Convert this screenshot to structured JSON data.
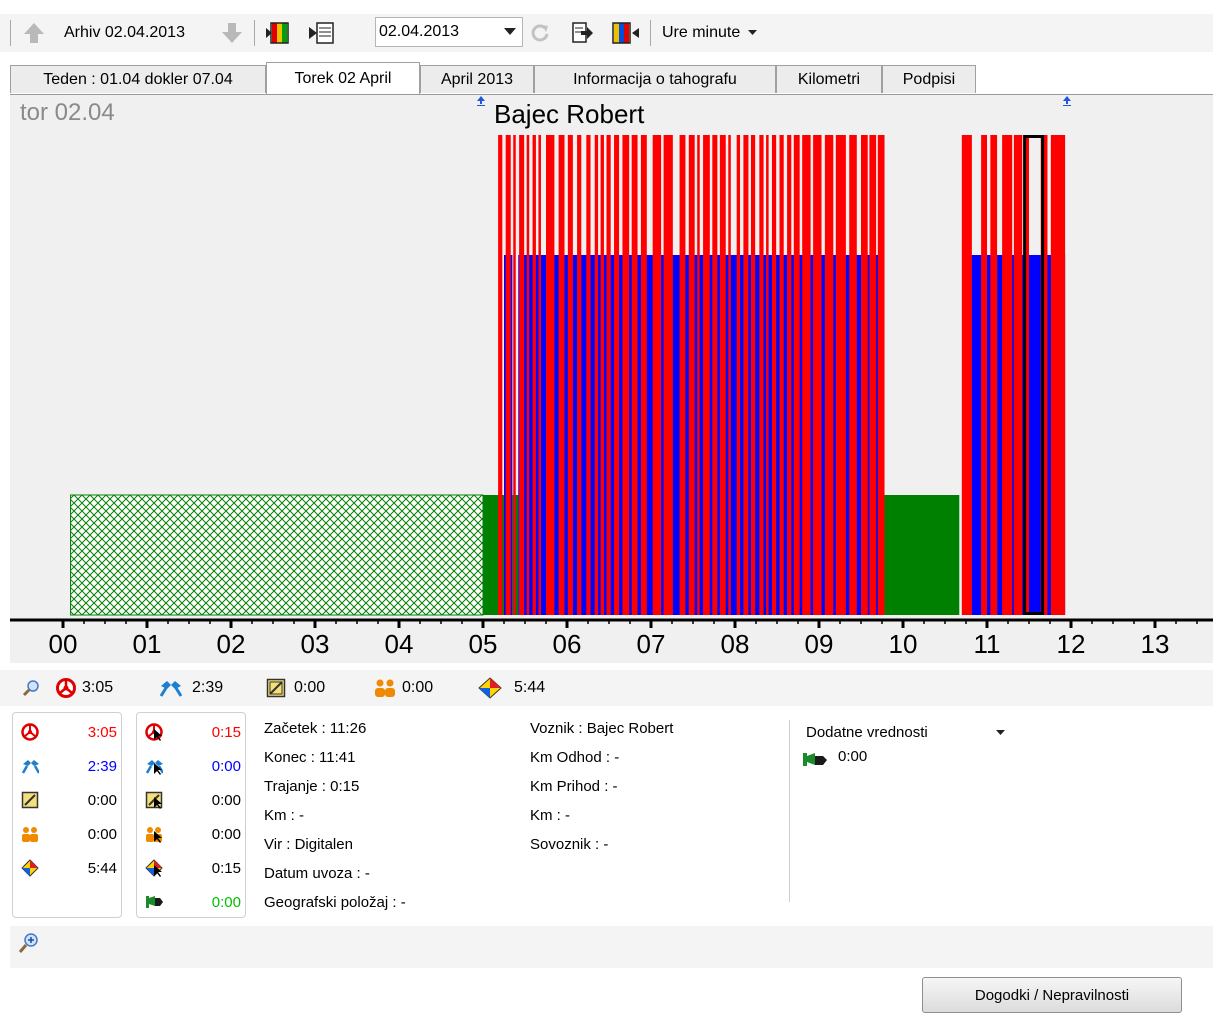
{
  "toolbar": {
    "archive_label": "Arhiv 02.04.2013",
    "date_value": "02.04.2013",
    "mode_label": "Ure minute"
  },
  "tabs": [
    {
      "label": "Teden : 01.04 dokler 07.04",
      "active": false
    },
    {
      "label": "Torek 02 April",
      "active": true
    },
    {
      "label": "April 2013",
      "active": false
    },
    {
      "label": "Informacija o tahografu",
      "active": false
    },
    {
      "label": "Kilometri",
      "active": false
    },
    {
      "label": "Podpisi",
      "active": false
    }
  ],
  "chart": {
    "day_label": "tor 02.04",
    "driver_name": "Bajec Robert"
  },
  "chart_data": {
    "type": "bar",
    "x_ticks": [
      "00",
      "01",
      "02",
      "03",
      "04",
      "05",
      "06",
      "07",
      "08",
      "09",
      "10",
      "11",
      "12",
      "13"
    ],
    "xlim": [
      0,
      13.6
    ],
    "activity_levels": {
      "rest": 1,
      "work": 3,
      "driving": 4
    },
    "segments": [
      {
        "activity": "rest_hatched",
        "start": 0.09,
        "end": 5.0
      },
      {
        "activity": "rest",
        "start": 5.0,
        "end": 5.25
      },
      {
        "activity": "work",
        "start": 5.25,
        "end": 5.35
      },
      {
        "activity": "rest",
        "start": 5.35,
        "end": 5.42
      },
      {
        "activity": "work",
        "start": 5.42,
        "end": 9.75
      },
      {
        "activity": "rest",
        "start": 9.78,
        "end": 10.67
      },
      {
        "activity": "work",
        "start": 10.78,
        "end": 11.05
      },
      {
        "activity": "rest",
        "start": 11.05,
        "end": 11.12
      },
      {
        "activity": "work",
        "start": 11.12,
        "end": 11.93
      }
    ],
    "driving_segments": [
      [
        5.18,
        5.23
      ],
      [
        5.27,
        5.33
      ],
      [
        5.36,
        5.39
      ],
      [
        5.43,
        5.49
      ],
      [
        5.52,
        5.55
      ],
      [
        5.59,
        5.63
      ],
      [
        5.66,
        5.69
      ],
      [
        5.75,
        5.85
      ],
      [
        5.9,
        5.97
      ],
      [
        6.01,
        6.07
      ],
      [
        6.12,
        6.17
      ],
      [
        6.23,
        6.28
      ],
      [
        6.33,
        6.37
      ],
      [
        6.4,
        6.44
      ],
      [
        6.47,
        6.52
      ],
      [
        6.56,
        6.62
      ],
      [
        6.66,
        6.74
      ],
      [
        6.77,
        6.84
      ],
      [
        6.88,
        6.95
      ],
      [
        7.02,
        7.12
      ],
      [
        7.15,
        7.26
      ],
      [
        7.34,
        7.41
      ],
      [
        7.45,
        7.52
      ],
      [
        7.55,
        7.58
      ],
      [
        7.62,
        7.7
      ],
      [
        7.73,
        7.79
      ],
      [
        7.82,
        7.89
      ],
      [
        7.92,
        7.95
      ],
      [
        8.02,
        8.06
      ],
      [
        8.1,
        8.16
      ],
      [
        8.19,
        8.24
      ],
      [
        8.29,
        8.34
      ],
      [
        8.37,
        8.4
      ],
      [
        8.44,
        8.49
      ],
      [
        8.53,
        8.58
      ],
      [
        8.62,
        8.67
      ],
      [
        8.7,
        8.77
      ],
      [
        8.8,
        8.9
      ],
      [
        8.93,
        9.03
      ],
      [
        9.07,
        9.17
      ],
      [
        9.2,
        9.32
      ],
      [
        9.36,
        9.45
      ],
      [
        9.5,
        9.58
      ],
      [
        9.6,
        9.68
      ],
      [
        9.7,
        9.78
      ],
      [
        10.7,
        10.82
      ],
      [
        10.93,
        11.0
      ],
      [
        11.04,
        11.12
      ],
      [
        11.18,
        11.3
      ],
      [
        11.32,
        11.42
      ],
      [
        11.44,
        11.5
      ],
      [
        11.64,
        11.72
      ],
      [
        11.76,
        11.93
      ]
    ],
    "selected_segment": [
      11.43,
      11.68
    ],
    "colors": {
      "driving": "#ff0000",
      "work": "#0000ff",
      "rest": "#008000",
      "grid": "#000000"
    }
  },
  "summary": {
    "driving": "3:05",
    "work": "2:39",
    "availability": "0:00",
    "crew": "0:00",
    "rest": "5:44"
  },
  "details": {
    "left": [
      {
        "icon": "driving-icon",
        "value": "3:05",
        "color": "#ff0000"
      },
      {
        "icon": "work-icon",
        "value": "2:39",
        "color": "#0000ff"
      },
      {
        "icon": "availability-icon",
        "value": "0:00",
        "color": "#000000"
      },
      {
        "icon": "crew-icon",
        "value": "0:00",
        "color": "#000000"
      },
      {
        "icon": "rest-icon",
        "value": "5:44",
        "color": "#000000"
      }
    ],
    "selection": [
      {
        "icon": "driving-select-icon",
        "value": "0:15",
        "color": "#ff0000"
      },
      {
        "icon": "work-select-icon",
        "value": "0:00",
        "color": "#0000ff"
      },
      {
        "icon": "availability-select-icon",
        "value": "0:00",
        "color": "#000000"
      },
      {
        "icon": "crew-select-icon",
        "value": "0:00",
        "color": "#000000"
      },
      {
        "icon": "rest-select-icon",
        "value": "0:15",
        "color": "#000000"
      },
      {
        "icon": "ferry-icon",
        "value": "0:00",
        "color": "#00c000"
      }
    ],
    "info": [
      "Začetek : 11:26",
      "Konec : 11:41",
      "Trajanje : 0:15",
      "Km :   -",
      "Vir : Digitalen",
      "Datum uvoza :   -",
      "Geografski položaj :   -"
    ],
    "driver_info": [
      "Voznik : Bajec Robert",
      "Km Odhod :   -",
      "Km Prihod :   -",
      "Km :   -",
      "Sovoznik :   -"
    ],
    "extra_title": "Dodatne vrednosti",
    "extra_value": "0:00"
  },
  "buttons": {
    "events": "Dogodki / Nepravilnosti"
  }
}
